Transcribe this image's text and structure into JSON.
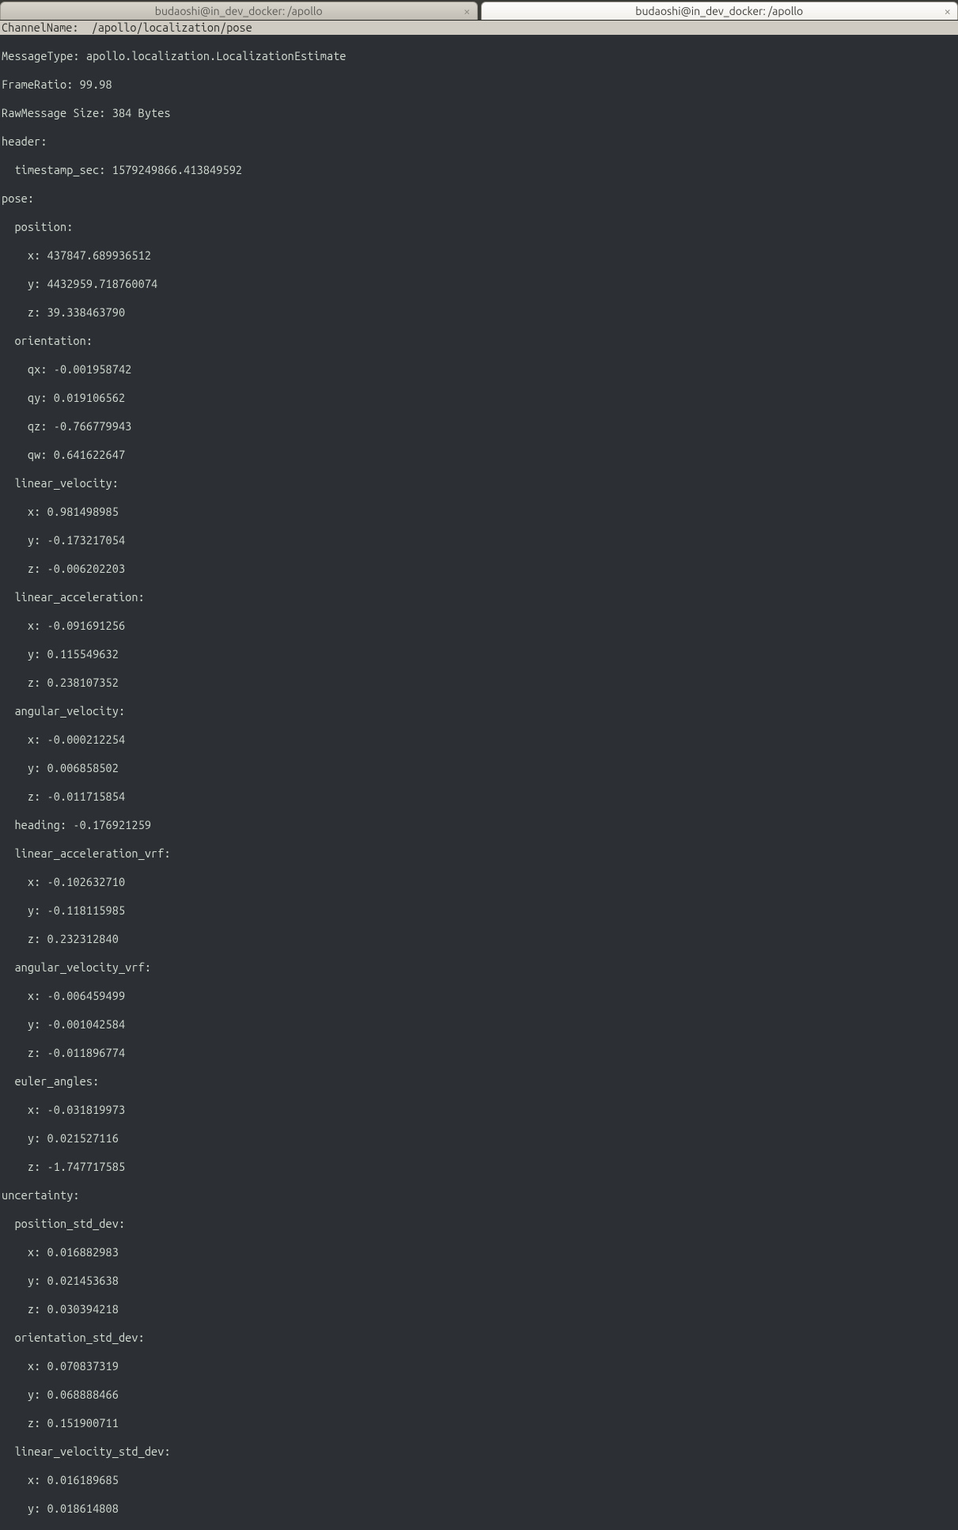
{
  "tabs": {
    "left": "budaoshi@in_dev_docker: /apollo",
    "right": "budaoshi@in_dev_docker: /apollo",
    "close_glyph": "×"
  },
  "channel_name_label": "ChannelName:  ",
  "channel_name_value": "/apollo/localization/pose",
  "msg": {
    "message_type": "MessageType: apollo.localization.LocalizationEstimate",
    "frame_ratio": "FrameRatio: 99.98",
    "raw_size": "RawMessage Size: 384 Bytes",
    "header_label": "header:",
    "timestamp": "  timestamp_sec: 1579249866.413849592",
    "pose_label": "pose:",
    "position_label": "  position:",
    "position_x": "    x: 437847.689936512",
    "position_y": "    y: 4432959.718760074",
    "position_z": "    z: 39.338463790",
    "orientation_label": "  orientation:",
    "orientation_qx": "    qx: -0.001958742",
    "orientation_qy": "    qy: 0.019106562",
    "orientation_qz": "    qz: -0.766779943",
    "orientation_qw": "    qw: 0.641622647",
    "lin_vel_label": "  linear_velocity:",
    "lin_vel_x": "    x: 0.981498985",
    "lin_vel_y": "    y: -0.173217054",
    "lin_vel_z": "    z: -0.006202203",
    "lin_acc_label": "  linear_acceleration:",
    "lin_acc_x": "    x: -0.091691256",
    "lin_acc_y": "    y: 0.115549632",
    "lin_acc_z": "    z: 0.238107352",
    "ang_vel_label": "  angular_velocity:",
    "ang_vel_x": "    x: -0.000212254",
    "ang_vel_y": "    y: 0.006858502",
    "ang_vel_z": "    z: -0.011715854",
    "heading": "  heading: -0.176921259",
    "lin_acc_vrf_label": "  linear_acceleration_vrf:",
    "lin_acc_vrf_x": "    x: -0.102632710",
    "lin_acc_vrf_y": "    y: -0.118115985",
    "lin_acc_vrf_z": "    z: 0.232312840",
    "ang_vel_vrf_label": "  angular_velocity_vrf:",
    "ang_vel_vrf_x": "    x: -0.006459499",
    "ang_vel_vrf_y": "    y: -0.001042584",
    "ang_vel_vrf_z": "    z: -0.011896774",
    "euler_label": "  euler_angles:",
    "euler_x": "    x: -0.031819973",
    "euler_y": "    y: 0.021527116",
    "euler_z": "    z: -1.747717585",
    "uncertainty_label": "uncertainty:",
    "pos_std_label": "  position_std_dev:",
    "pos_std_x": "    x: 0.016882983",
    "pos_std_y": "    y: 0.021453638",
    "pos_std_z": "    z: 0.030394218",
    "ori_std_label": "  orientation_std_dev:",
    "ori_std_x": "    x: 0.070837319",
    "ori_std_y": "    y: 0.068888466",
    "ori_std_z": "    z: 0.151900711",
    "lv_std_label": "  linear_velocity_std_dev:",
    "lv_std_x": "    x: 0.016189685",
    "lv_std_y": "    y: 0.018614808"
  }
}
